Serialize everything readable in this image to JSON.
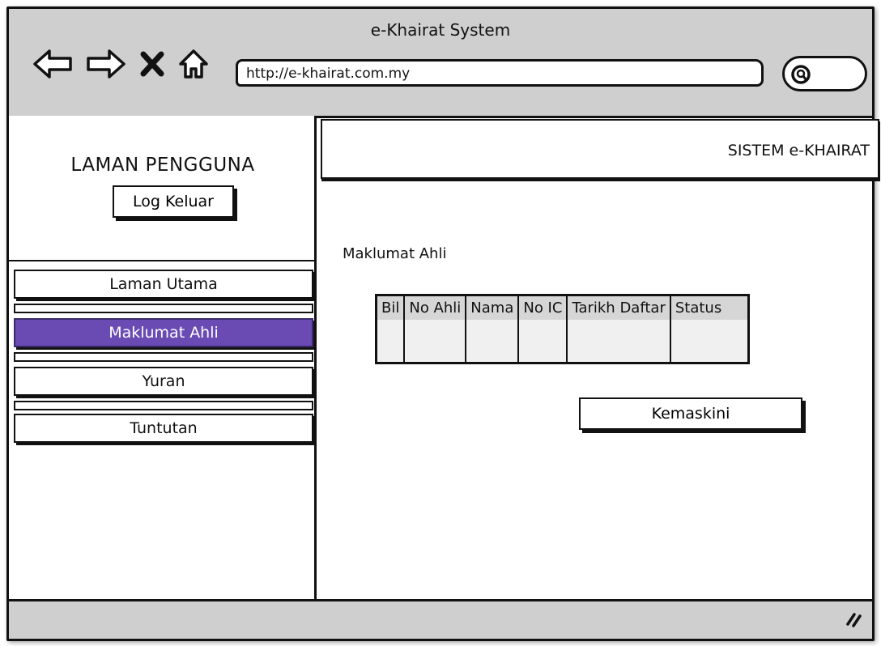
{
  "window": {
    "title": "e-Khairat System"
  },
  "browser": {
    "url": "http://e-khairat.com.my",
    "nav_icons": [
      "back-arrow-icon",
      "forward-arrow-icon",
      "close-icon",
      "home-icon"
    ],
    "search_icon": "search-icon"
  },
  "sidebar": {
    "title": "LAMAN PENGGUNA",
    "logout_label": "Log Keluar",
    "items": [
      {
        "label": "Laman Utama",
        "active": false
      },
      {
        "label": "Maklumat Ahli",
        "active": true
      },
      {
        "label": "Yuran",
        "active": false
      },
      {
        "label": "Tuntutan",
        "active": false
      }
    ],
    "active_color": "#6a4bb4"
  },
  "header": {
    "title": "SISTEM e-KHAIRAT"
  },
  "main": {
    "section_title": "Maklumat Ahli",
    "table": {
      "columns": [
        "Bil",
        "No Ahli",
        "Nama",
        "No IC",
        "Tarikh Daftar",
        "Status"
      ]
    },
    "update_label": "Kemaskini"
  }
}
